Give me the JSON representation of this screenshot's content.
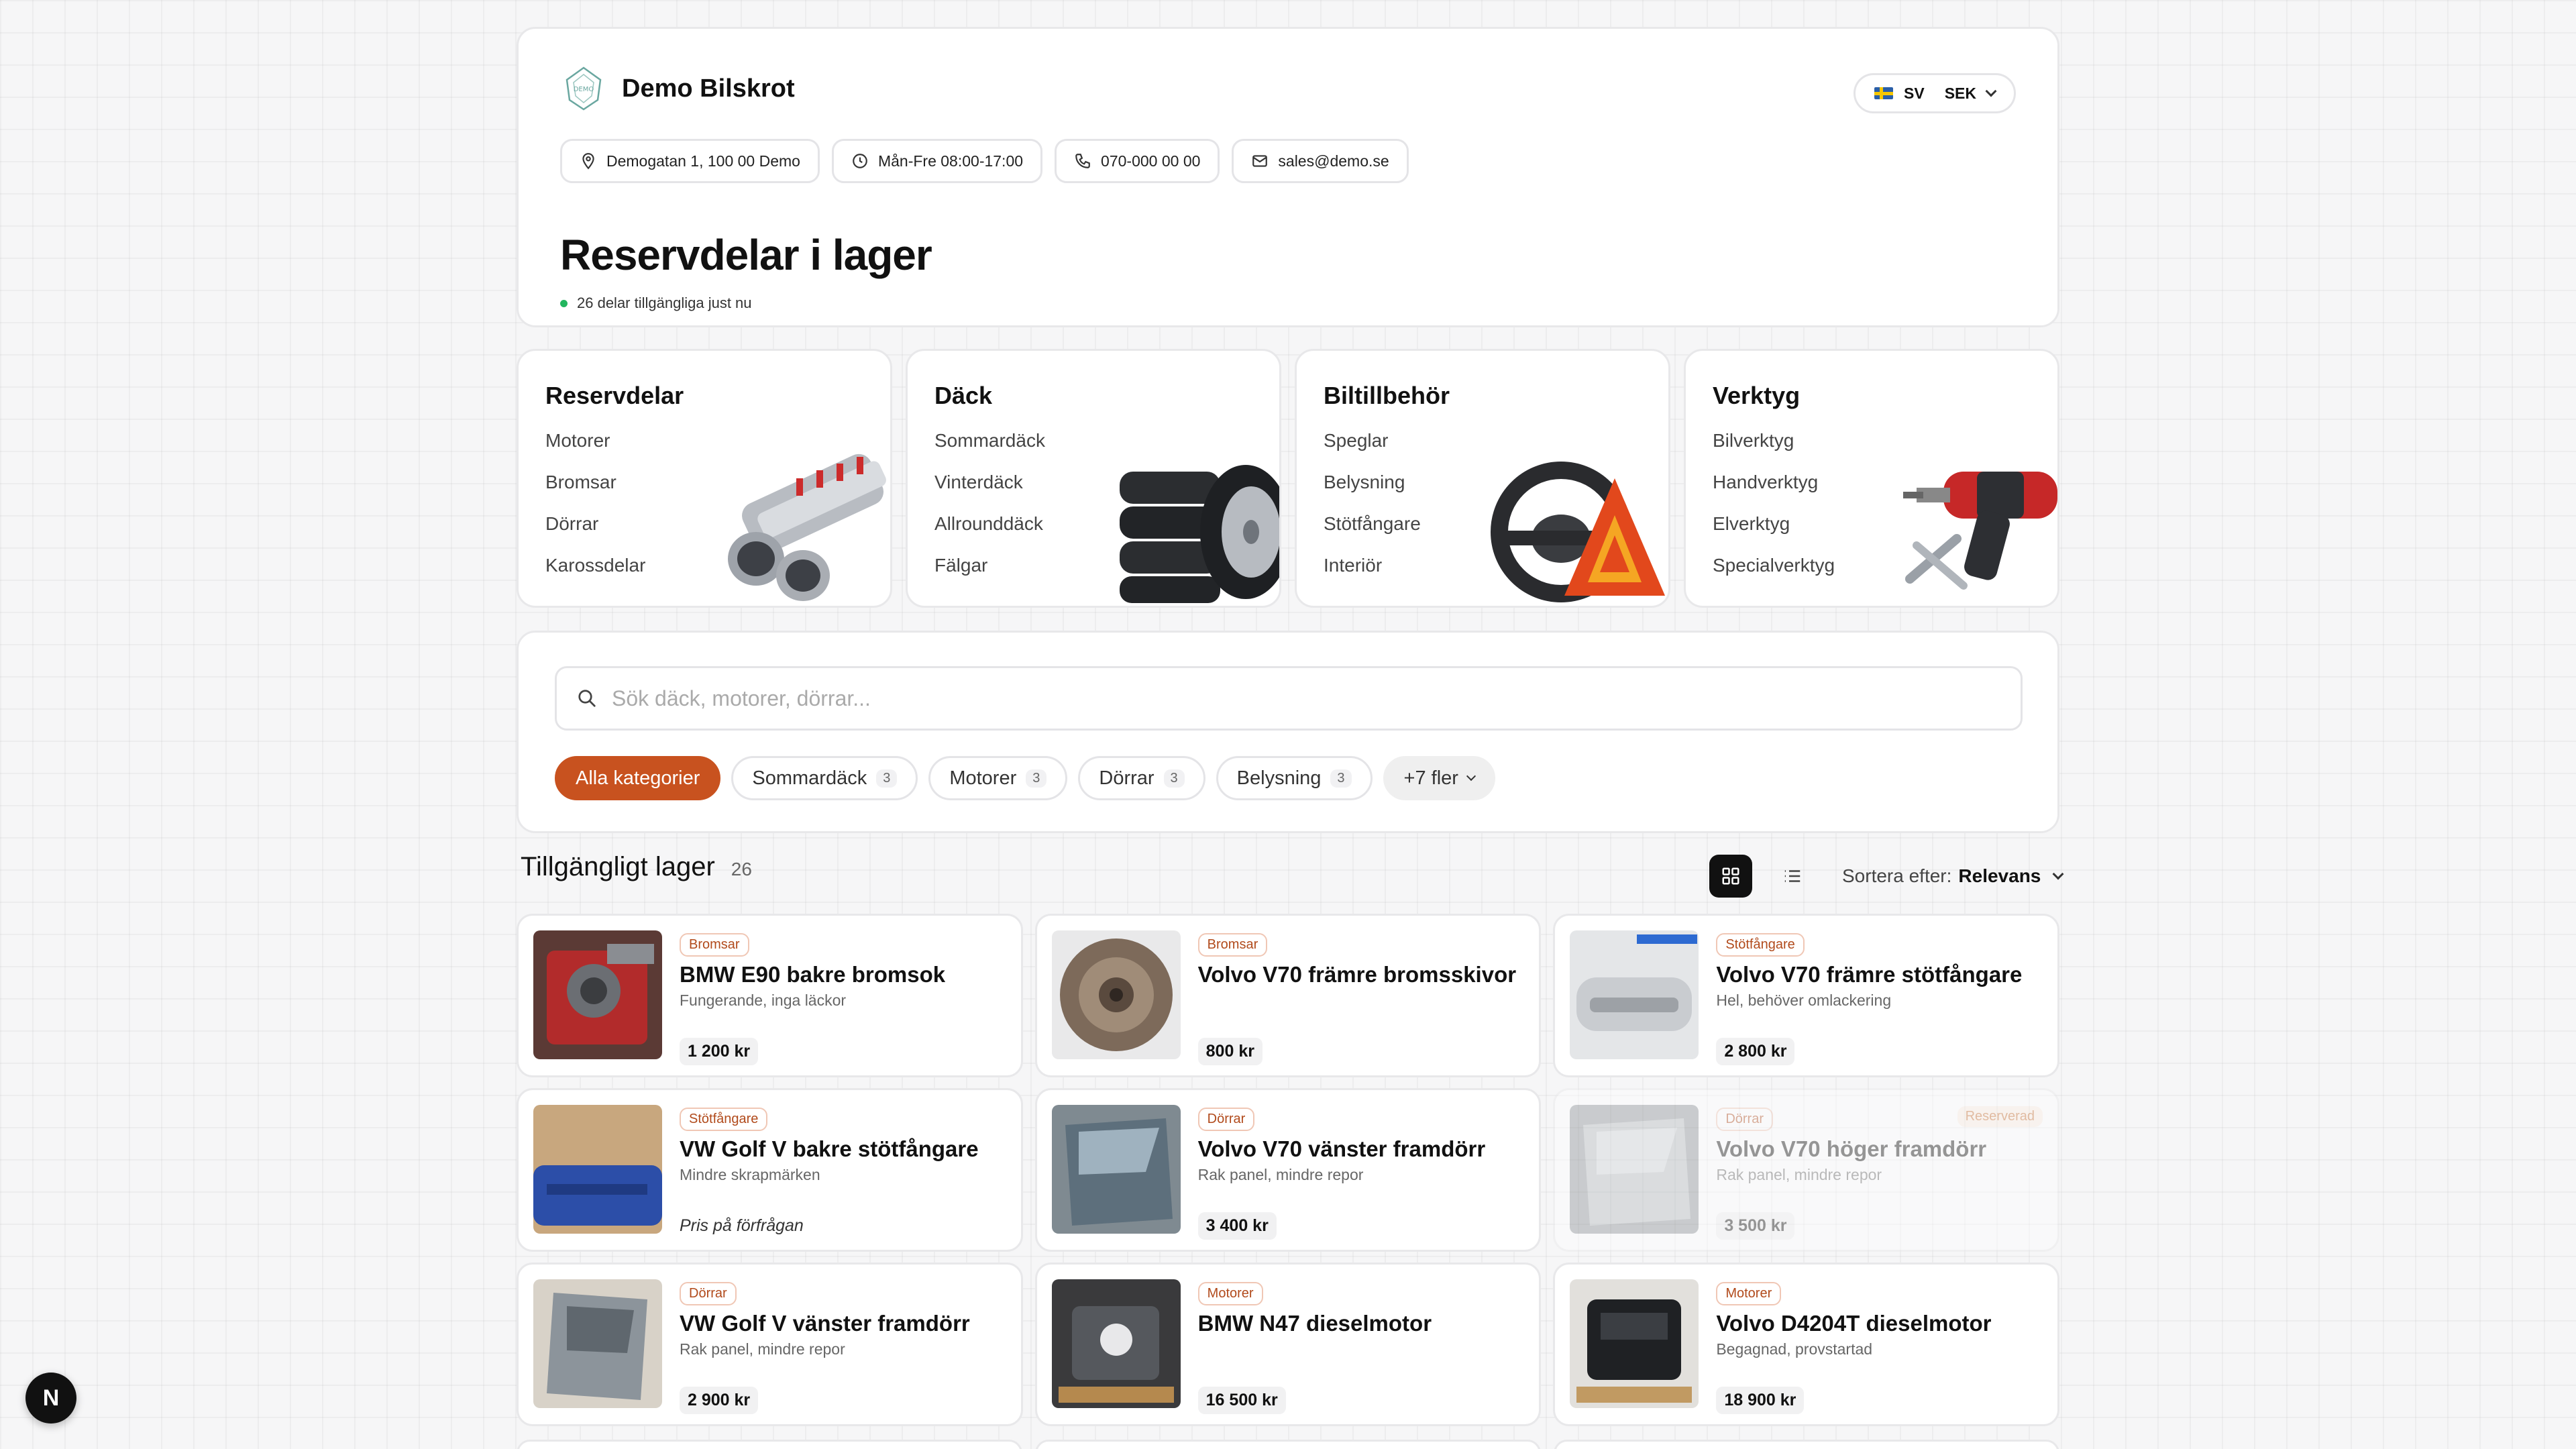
{
  "shop": {
    "name": "Demo Bilskrot",
    "lang": "SV",
    "currency": "SEK",
    "address": "Demogatan 1, 100 00 Demo",
    "hours": "Mån-Fre 08:00-17:00",
    "phone": "070-000 00 00",
    "email": "sales@demo.se"
  },
  "page": {
    "title": "Reservdelar i lager",
    "available_text": "26 delar tillgängliga just nu"
  },
  "categories": [
    {
      "title": "Reservdelar",
      "items": [
        "Motorer",
        "Bromsar",
        "Dörrar",
        "Karossdelar"
      ]
    },
    {
      "title": "Däck",
      "items": [
        "Sommardäck",
        "Vinterdäck",
        "Allrounddäck",
        "Fälgar"
      ]
    },
    {
      "title": "Biltillbehör",
      "items": [
        "Speglar",
        "Belysning",
        "Stötfångare",
        "Interiör"
      ]
    },
    {
      "title": "Verktyg",
      "items": [
        "Bilverktyg",
        "Handverktyg",
        "Elverktyg",
        "Specialverktyg"
      ]
    }
  ],
  "search": {
    "placeholder": "Sök däck, motorer, dörrar..."
  },
  "chips": [
    {
      "label": "Alla kategorier",
      "count": ""
    },
    {
      "label": "Sommardäck",
      "count": "3"
    },
    {
      "label": "Motorer",
      "count": "3"
    },
    {
      "label": "Dörrar",
      "count": "3"
    },
    {
      "label": "Belysning",
      "count": "3"
    },
    {
      "label": "+7 fler",
      "count": ""
    }
  ],
  "listing": {
    "title": "Tillgängligt lager",
    "count": "26",
    "sort_label": "Sortera efter:",
    "sort_value": "Relevans"
  },
  "products": [
    {
      "tag": "Bromsar",
      "title": "BMW E90 bakre bromsok",
      "desc": "Fungerande, inga läckor",
      "price": "1 200 kr",
      "reserved": ""
    },
    {
      "tag": "Bromsar",
      "title": "Volvo V70 främre bromsskivor",
      "desc": "",
      "price": "800 kr",
      "reserved": ""
    },
    {
      "tag": "Stötfångare",
      "title": "Volvo V70 främre stötfångare",
      "desc": "Hel, behöver omlackering",
      "price": "2 800 kr",
      "reserved": ""
    },
    {
      "tag": "Stötfångare",
      "title": "VW Golf V bakre stötfångare",
      "desc": "Mindre skrapmärken",
      "price": "Pris på förfrågan",
      "reserved": ""
    },
    {
      "tag": "Dörrar",
      "title": "Volvo V70 vänster framdörr",
      "desc": "Rak panel, mindre repor",
      "price": "3 400 kr",
      "reserved": ""
    },
    {
      "tag": "Dörrar",
      "title": "Volvo V70 höger framdörr",
      "desc": "Rak panel, mindre repor",
      "price": "3 500 kr",
      "reserved": "Reserverad"
    },
    {
      "tag": "Dörrar",
      "title": "VW Golf V vänster framdörr",
      "desc": "Rak panel, mindre repor",
      "price": "2 900 kr",
      "reserved": ""
    },
    {
      "tag": "Motorer",
      "title": "BMW N47 dieselmotor",
      "desc": "",
      "price": "16 500 kr",
      "reserved": ""
    },
    {
      "tag": "Motorer",
      "title": "Volvo D4204T dieselmotor",
      "desc": "Begagnad, provstartad",
      "price": "18 900 kr",
      "reserved": ""
    }
  ],
  "dev_badge": "N"
}
